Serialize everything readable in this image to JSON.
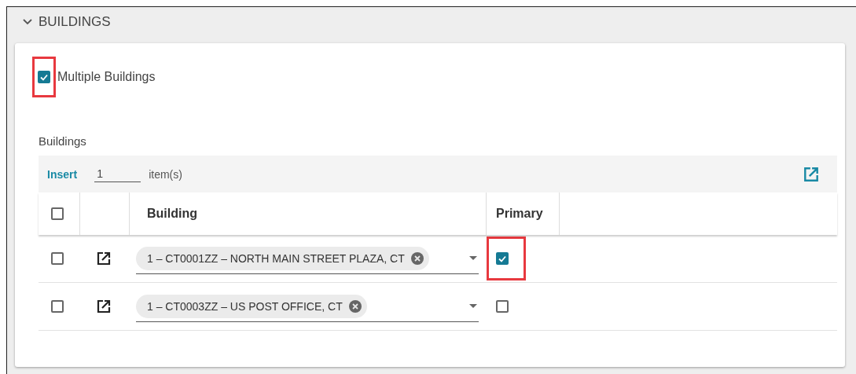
{
  "section": {
    "title": "BUILDINGS",
    "expanded": true
  },
  "multiple_buildings": {
    "label": "Multiple Buildings",
    "checked": true,
    "highlighted": true
  },
  "grid": {
    "label": "Buildings",
    "insert": {
      "button": "Insert",
      "value": "1",
      "unit": "item(s)"
    },
    "header": {
      "select_all": false,
      "columns": [
        "Building",
        "Primary"
      ]
    },
    "rows": [
      {
        "selected": false,
        "building": "1 – CT0001ZZ – NORTH MAIN STREET PLAZA, CT",
        "primary": true,
        "highlighted": true
      },
      {
        "selected": false,
        "building": "1 – CT0003ZZ – US POST OFFICE, CT",
        "primary": false,
        "highlighted": false
      }
    ]
  }
}
